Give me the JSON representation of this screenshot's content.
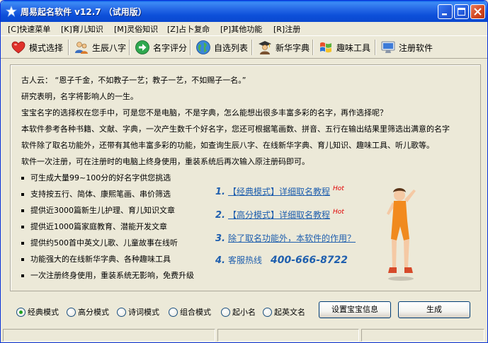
{
  "window": {
    "title": "周易起名软件 v12.7 （试用版）"
  },
  "menu": [
    {
      "label": "[C]快速菜单"
    },
    {
      "label": "[K]育儿知识"
    },
    {
      "label": "[M]灵俗知识"
    },
    {
      "label": "[Z]占卜复命"
    },
    {
      "label": "[P]其他功能"
    },
    {
      "label": "[R]注册"
    }
  ],
  "toolbar": [
    {
      "label": "模式选择",
      "icon": "heart-icon"
    },
    {
      "label": "生辰八字",
      "icon": "people-icon"
    },
    {
      "label": "名字评分",
      "icon": "arrow-right-icon"
    },
    {
      "label": "自选列表",
      "icon": "globe-icon"
    },
    {
      "label": "新华字典",
      "icon": "scholar-icon"
    },
    {
      "label": "趣味工具",
      "icon": "windows-flag-icon"
    },
    {
      "label": "注册软件",
      "icon": "monitor-icon"
    }
  ],
  "intro": [
    "古人云：  “恩子千金，不如教子一艺；教子一艺，不如赐子一名。”",
    "研究表明，名字将影响人的一生。",
    "宝宝名字的选择权在您手中，可是您不是电脑，不是字典，怎么能想出很多丰富多彩的名字，再作选择呢？",
    "本软件参考各种书籍、文献、字典，一次产生数千个好名字，您还可根据笔画数、拼音、五行在输出结果里筛选出满意的名字",
    "软件除了取名功能外，还带有其他丰富多彩的功能，如查询生辰八字、在线新华字典、育儿知识、趣味工具、听儿歌等。",
    "软件一次注册，可在注册时的电脑上终身使用，重装系统后再次输入原注册码即可。"
  ],
  "features": [
    "可生成大量99~100分的好名字供您挑选",
    "支持按五行、简体、康熙笔画、串价筛选",
    "提供近3000篇新生儿护理、育儿知识文章",
    "提供近1000篇家庭教育、潜能开发文章",
    "提供约500首中英文儿歌、儿童故事在线听",
    "功能强大的在线新华字典、各种趣味工具",
    "一次注册终身使用，重装系统无影响，免费升级"
  ],
  "links": [
    {
      "num": "1.",
      "text": "【经典模式】详细取名教程",
      "hot": "Hot"
    },
    {
      "num": "2.",
      "text": "【高分模式】详细取名教程",
      "hot": "Hot"
    },
    {
      "num": "3.",
      "text": "除了取名功能外，本软件的作用？",
      "hot": ""
    },
    {
      "num": "4.",
      "text": "客服热线",
      "phone": "400-666-8722"
    }
  ],
  "modes": [
    {
      "label": "经典模式",
      "selected": true
    },
    {
      "label": "高分模式",
      "selected": false
    },
    {
      "label": "诗词模式",
      "selected": false
    },
    {
      "label": "组合模式",
      "selected": false
    },
    {
      "label": "起小名",
      "selected": false
    },
    {
      "label": "起英文名",
      "selected": false
    }
  ],
  "buttons": {
    "settings": "设置宝宝信息",
    "generate": "生成"
  },
  "colors": {
    "titlebar": "#0C4FD9",
    "window_bg": "#ECE9D8",
    "link": "#1F5FAE",
    "hot": "#E00000"
  }
}
